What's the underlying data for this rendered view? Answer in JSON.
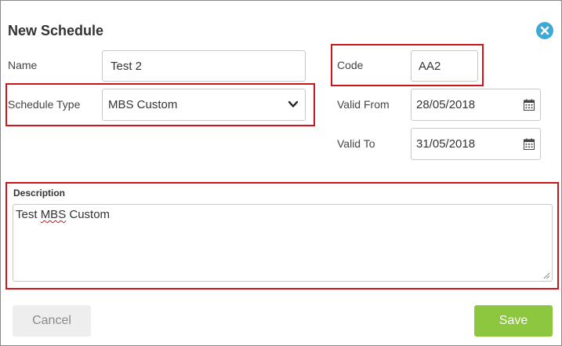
{
  "dialog": {
    "title": "New Schedule"
  },
  "fields": {
    "name_label": "Name",
    "name_value": "Test 2",
    "code_label": "Code",
    "code_value": "AA2",
    "schedule_type_label": "Schedule Type",
    "schedule_type_value": "MBS Custom",
    "valid_from_label": "Valid From",
    "valid_from_value": "28/05/2018",
    "valid_to_label": "Valid To",
    "valid_to_value": "31/05/2018",
    "description_label": "Description",
    "description_word1": "Test ",
    "description_word2": "MBS",
    "description_word3": " Custom"
  },
  "actions": {
    "cancel_label": "Cancel",
    "save_label": "Save"
  },
  "colors": {
    "highlight": "#d0121b",
    "save_button": "#8dc63f",
    "close_button": "#3fa9d6"
  },
  "icons": {
    "close": "close-icon",
    "dropdown": "chevron-down-icon",
    "calendar": "calendar-icon"
  }
}
